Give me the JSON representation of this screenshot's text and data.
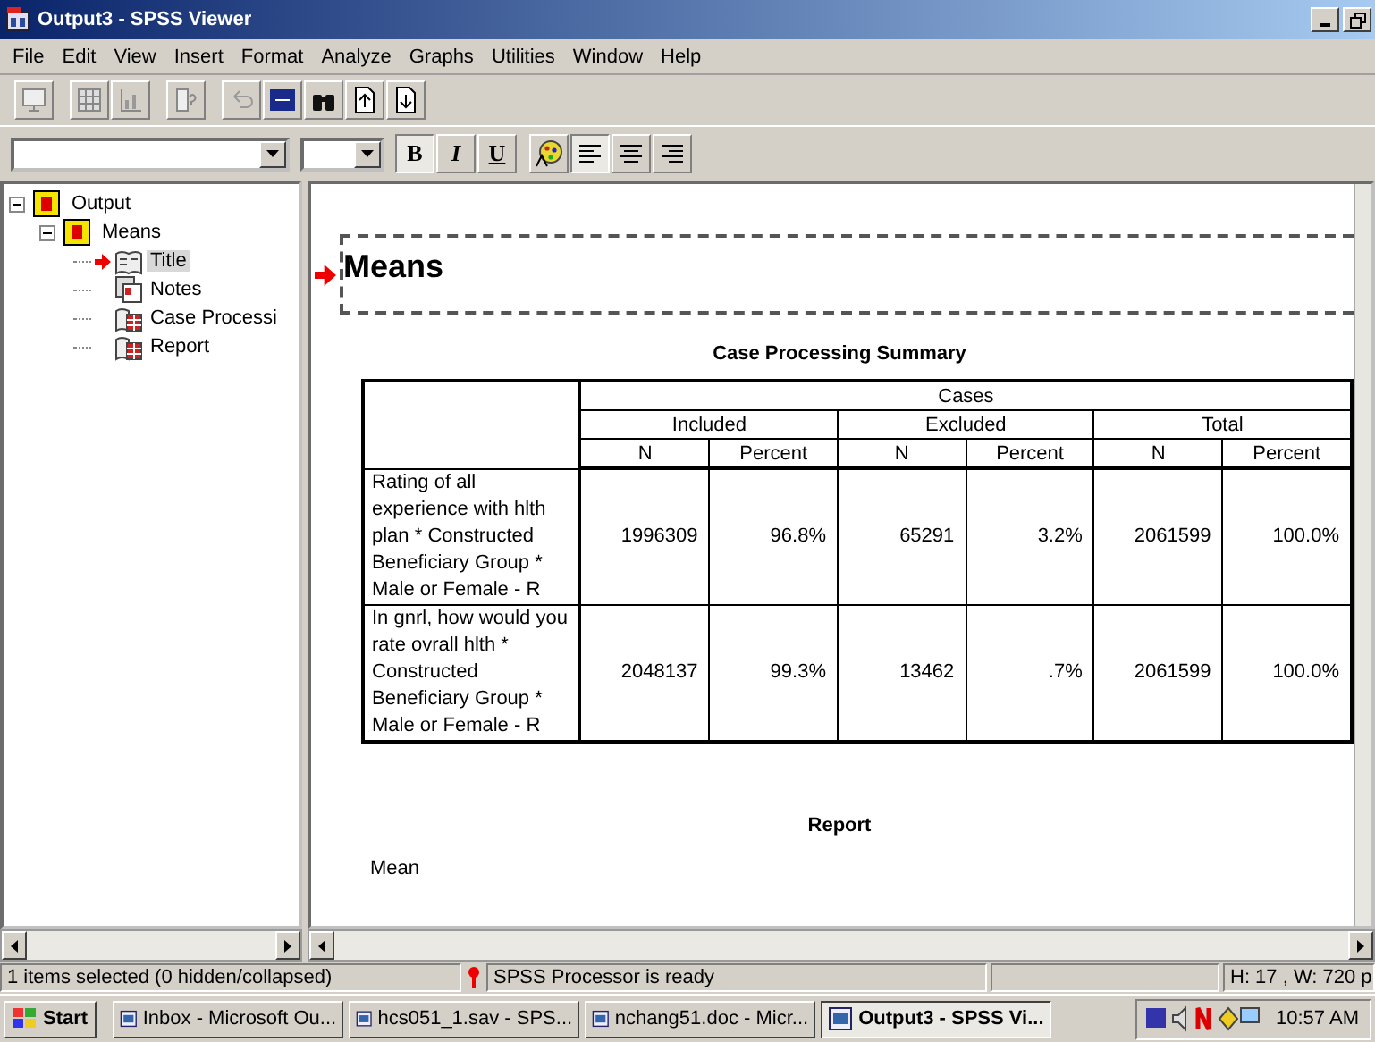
{
  "window": {
    "title": "Output3 - SPSS Viewer"
  },
  "menu": [
    "File",
    "Edit",
    "View",
    "Insert",
    "Format",
    "Analyze",
    "Graphs",
    "Utilities",
    "Window",
    "Help"
  ],
  "toolbar": [
    {
      "kind": "monitor"
    },
    {
      "kind": "grid"
    },
    {
      "kind": "chart"
    },
    {
      "kind": "help"
    },
    {
      "kind": "undo"
    },
    {
      "kind": "label"
    },
    {
      "kind": "find"
    },
    {
      "kind": "up"
    },
    {
      "kind": "down"
    }
  ],
  "format_bar": {
    "buttons": [
      {
        "label": "B",
        "pressed": true
      },
      {
        "label": "I",
        "pressed": false
      },
      {
        "label": "U",
        "pressed": false
      }
    ],
    "align": [
      {
        "kind": "left",
        "pressed": true
      },
      {
        "kind": "center",
        "pressed": false
      },
      {
        "kind": "right",
        "pressed": false
      }
    ]
  },
  "outline": [
    {
      "label": "Output",
      "expanded": true,
      "selected": false,
      "children": [
        {
          "label": "Means",
          "expanded": true,
          "selected": false,
          "children": [
            {
              "label": "Title",
              "kind": "title",
              "selected": true
            },
            {
              "label": "Notes",
              "kind": "notes",
              "selected": false
            },
            {
              "label": "Case Processi",
              "kind": "table",
              "selected": false
            },
            {
              "label": "Report",
              "kind": "table",
              "selected": false
            }
          ]
        }
      ]
    }
  ],
  "document": {
    "heading": "Means",
    "table": {
      "title": "Case Processing Summary",
      "group": "Cases",
      "subgroups": [
        "Included",
        "Excluded",
        "Total"
      ],
      "columns": [
        "N",
        "Percent",
        "N",
        "Percent",
        "N",
        "Percent"
      ],
      "rows": [
        {
          "label": "Rating of all experience with hlth plan  * Constructed Beneficiary Group * Male or Female  - R",
          "values": [
            "1996309",
            "96.8%",
            "65291",
            "3.2%",
            "2061599",
            "100.0%"
          ]
        },
        {
          "label": "In gnrl, how would you rate ovrall hlth  * Constructed Beneficiary Group * Male or Female  - R",
          "values": [
            "2048137",
            "99.3%",
            "13462",
            ".7%",
            "2061599",
            "100.0%"
          ]
        }
      ]
    },
    "report_title": "Report",
    "report_first_line": "Mean"
  },
  "status_bar": {
    "selection": "1 items selected (0 hidden/collapsed)",
    "processor": "SPSS Processor  is ready",
    "size": "H: 17 , W: 720 p"
  },
  "taskbar": {
    "start": "Start",
    "tasks": [
      {
        "label": "Inbox - Microsoft Ou...",
        "selected": false
      },
      {
        "label": "hcs051_1.sav - SPS...",
        "selected": false
      },
      {
        "label": "nchang51.doc - Micr...",
        "selected": false
      },
      {
        "label": "Output3 - SPSS Vi...",
        "selected": true
      }
    ],
    "clock": "10:57 AM"
  }
}
